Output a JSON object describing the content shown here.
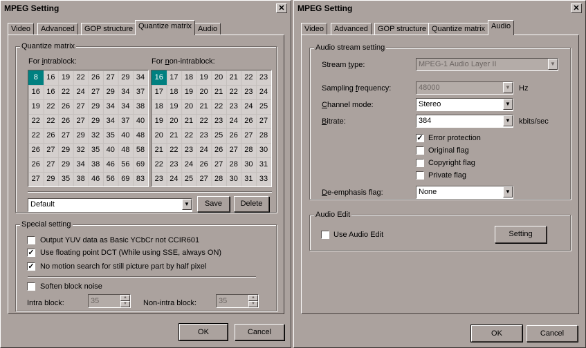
{
  "left": {
    "title": "MPEG Setting",
    "close": "✕",
    "tabs": [
      "Video",
      "Advanced",
      "GOP structure",
      "Quantize matrix",
      "Audio"
    ],
    "quant_group": "Quantize matrix",
    "intra_label": "For intrablock:",
    "nonintra_label": "For non-intrablock:",
    "intra_matrix": [
      [
        "8",
        "16",
        "19",
        "22",
        "26",
        "27",
        "29",
        "34"
      ],
      [
        "16",
        "16",
        "22",
        "24",
        "27",
        "29",
        "34",
        "37"
      ],
      [
        "19",
        "22",
        "26",
        "27",
        "29",
        "34",
        "34",
        "38"
      ],
      [
        "22",
        "22",
        "26",
        "27",
        "29",
        "34",
        "37",
        "40"
      ],
      [
        "22",
        "26",
        "27",
        "29",
        "32",
        "35",
        "40",
        "48"
      ],
      [
        "26",
        "27",
        "29",
        "32",
        "35",
        "40",
        "48",
        "58"
      ],
      [
        "26",
        "27",
        "29",
        "34",
        "38",
        "46",
        "56",
        "69"
      ],
      [
        "27",
        "29",
        "35",
        "38",
        "46",
        "56",
        "69",
        "83"
      ]
    ],
    "nonintra_matrix": [
      [
        "16",
        "17",
        "18",
        "19",
        "20",
        "21",
        "22",
        "23"
      ],
      [
        "17",
        "18",
        "19",
        "20",
        "21",
        "22",
        "23",
        "24"
      ],
      [
        "18",
        "19",
        "20",
        "21",
        "22",
        "23",
        "24",
        "25"
      ],
      [
        "19",
        "20",
        "21",
        "22",
        "23",
        "24",
        "26",
        "27"
      ],
      [
        "20",
        "21",
        "22",
        "23",
        "25",
        "26",
        "27",
        "28"
      ],
      [
        "21",
        "22",
        "23",
        "24",
        "26",
        "27",
        "28",
        "30"
      ],
      [
        "22",
        "23",
        "24",
        "26",
        "27",
        "28",
        "30",
        "31"
      ],
      [
        "23",
        "24",
        "25",
        "27",
        "28",
        "30",
        "31",
        "33"
      ]
    ],
    "preset": "Default",
    "save": "Save",
    "delete": "Delete",
    "special_group": "Special setting",
    "opt_yuv": "Output YUV data as Basic YCbCr not CCIR601",
    "opt_fpdct": "Use floating point DCT (While using SSE, always ON)",
    "opt_nomotion": "No motion search for still picture part by half pixel",
    "opt_soften": "Soften block noise",
    "intra_block_label": "Intra block:",
    "intra_block_value": "35",
    "nonintra_block_label": "Non-intra block:",
    "nonintra_block_value": "35",
    "ok": "OK",
    "cancel": "Cancel"
  },
  "right": {
    "title": "MPEG Setting",
    "close": "✕",
    "tabs": [
      "Video",
      "Advanced",
      "GOP structure",
      "Quantize matrix",
      "Audio"
    ],
    "stream_group": "Audio stream setting",
    "stream_type_label": "Stream type:",
    "stream_type_value": "MPEG-1 Audio Layer II",
    "sampling_label": "Sampling frequency:",
    "sampling_value": "48000",
    "sampling_unit": "Hz",
    "channel_label": "Channel mode:",
    "channel_value": "Stereo",
    "bitrate_label": "Bitrate:",
    "bitrate_value": "384",
    "bitrate_unit": "kbits/sec",
    "error_protection": "Error protection",
    "original_flag": "Original flag",
    "copyright_flag": "Copyright flag",
    "private_flag": "Private flag",
    "deemphasis_label": "De-emphasis flag:",
    "deemphasis_value": "None",
    "edit_group": "Audio Edit",
    "use_audio_edit": "Use Audio Edit",
    "setting": "Setting",
    "ok": "OK",
    "cancel": "Cancel"
  }
}
